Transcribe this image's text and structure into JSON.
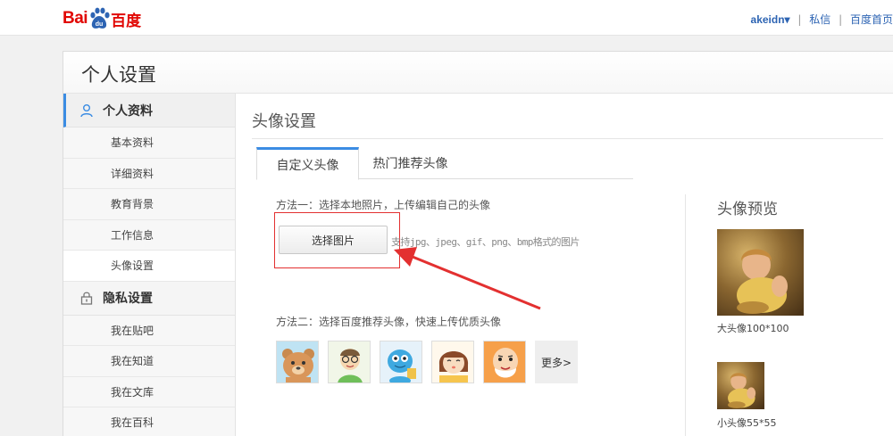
{
  "header": {
    "logo_left": "Bai",
    "logo_mid": "du",
    "logo_right": "百度",
    "username": "akeidn▾",
    "sep1": "|",
    "messages": "私信",
    "sep2": "|",
    "home": "百度首页"
  },
  "panel": {
    "title": "个人设置"
  },
  "sidebar": {
    "group_profile": "个人资料",
    "items_profile": [
      "基本资料",
      "详细资料",
      "教育背景",
      "工作信息",
      "头像设置"
    ],
    "group_privacy": "隐私设置",
    "items_privacy": [
      "我在贴吧",
      "我在知道",
      "我在文库",
      "我在百科"
    ]
  },
  "content": {
    "title": "头像设置",
    "tabs": [
      "自定义头像",
      "热门推荐头像"
    ],
    "method1": "方法一：选择本地照片，上传编辑自己的头像",
    "upload_button": "选择图片",
    "format_hint": "支持jpg、jpeg、gif、png、bmp格式的图片",
    "method2": "方法二：选择百度推荐头像，快速上传优质头像",
    "more": "更多>"
  },
  "preview": {
    "title": "头像预览",
    "big_label": "大头像100*100",
    "small_label": "小头像55*55"
  },
  "colors": {
    "accent": "#3b8ce3",
    "brand": "#e10602",
    "link": "#2d64b3",
    "annotation": "#e33030"
  }
}
